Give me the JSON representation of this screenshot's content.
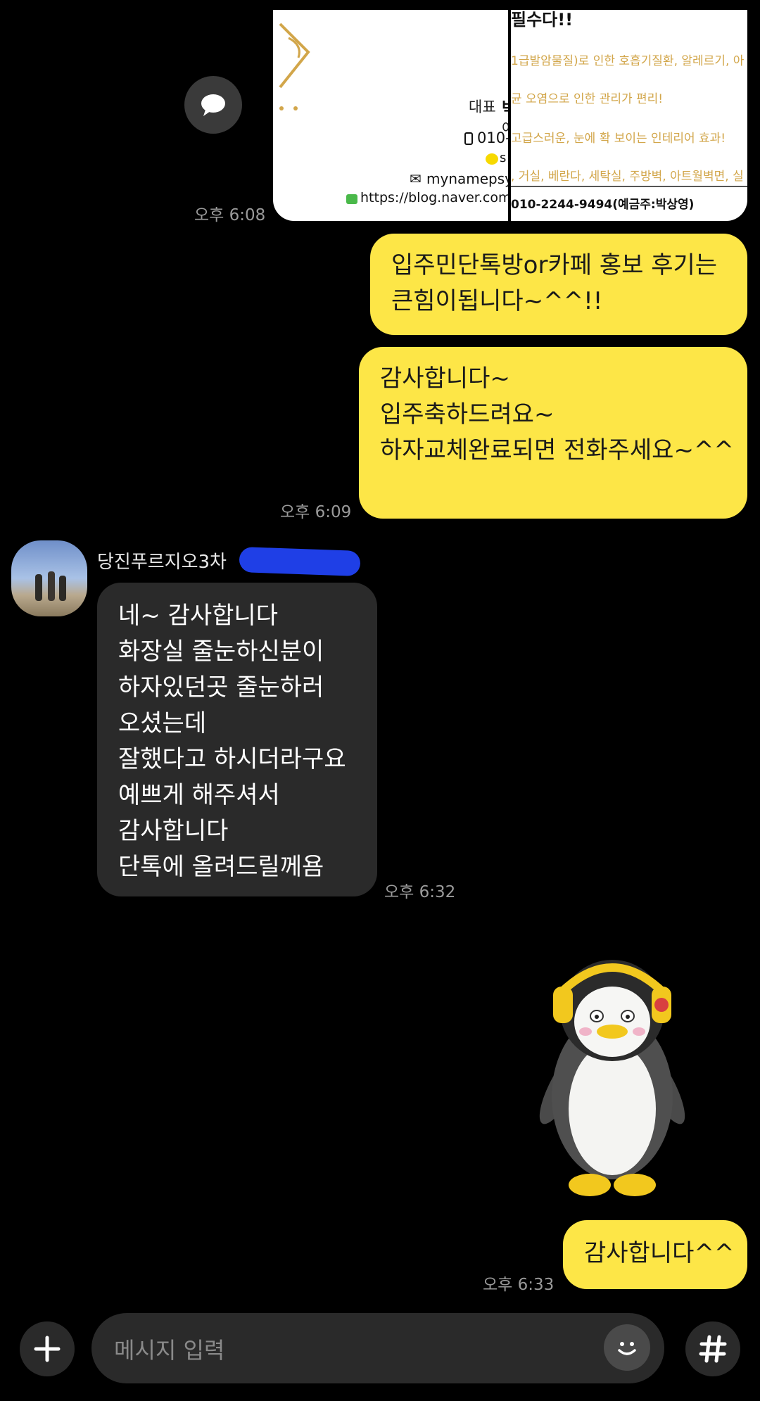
{
  "shared_image": {
    "card1": {
      "title_label": "대표",
      "name_partial": "박",
      "subtitle_partial": "어",
      "phone": "010-2",
      "kakao": "s",
      "email": "mynamepsy@",
      "blog": "https://blog.naver.com/m"
    },
    "card2": {
      "headline": "필수다!!",
      "lines": [
        "1급발암물질)로 인한 호흡기질환, 알레르기, 아",
        "균 오염으로 인한 관리가 편리!",
        "고급스러운, 눈에 확 보이는 인테리어 효과!",
        ", 거실, 베란다, 세탁실, 주방벽, 아트월벽면, 실"
      ],
      "account": "010-2244-9494(예금주:박상영)"
    }
  },
  "messages": {
    "t1": "오후 6:08",
    "m1": [
      "입주민단톡방or카페 홍보 후기는",
      "큰힘이됩니다~^^!!"
    ],
    "m2": [
      "감사합니다~",
      "입주축하드려요~",
      "",
      "하자교체완료되면 전화주세요~^^"
    ],
    "t2": "오후 6:09",
    "sender_name": "당진푸르지오3차",
    "m3": [
      "네~ 감사합니다",
      "화장실 줄눈하신분이",
      "하자있던곳 줄눈하러",
      "오셨는데",
      "잘했다고 하시더라구요",
      "예쁘게 해주셔서",
      "감사합니다",
      "단톡에 올려드릴께욤"
    ],
    "t3": "오후 6:32",
    "m4": "감사합니다^^",
    "t4": "오후 6:33"
  },
  "input": {
    "placeholder": "메시지 입력"
  },
  "colors": {
    "my_bubble": "#fde647",
    "other_bubble": "#2a2a2a",
    "background": "#000000"
  },
  "icons": {
    "share": "speech-bubble-icon",
    "add": "plus-icon",
    "emoji": "emoticon-icon",
    "hashtag": "hashtag-icon",
    "sticker": "penguin-sticker"
  }
}
